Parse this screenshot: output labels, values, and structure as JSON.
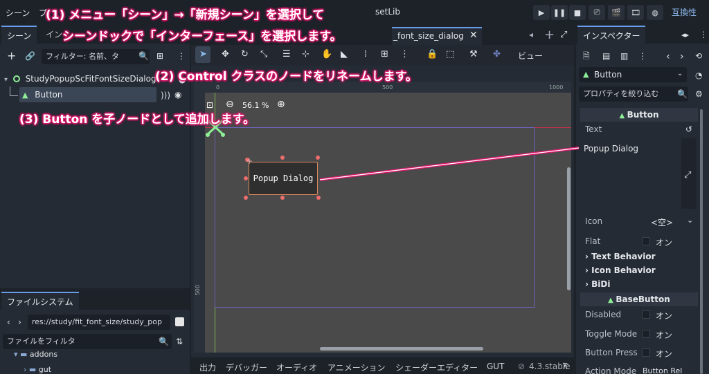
{
  "menubar": {
    "scene": "シーン",
    "project_partial": "プ",
    "assetlib_partial": "setLib",
    "compat": "互換性"
  },
  "scene_dock": {
    "tab_scene": "シーン",
    "tab_import_partial": "イン",
    "filter_placeholder": "フィルター: 名前、タ",
    "root_node": "StudyPopupScFitFontSizeDialog",
    "child_node": "Button"
  },
  "filesystem": {
    "tab": "ファイルシステム",
    "path": "res://study/fit_font_size/study_pop",
    "filter_placeholder": "ファイルをフィルタ",
    "folder1": "addons",
    "folder2": "gut"
  },
  "viewport": {
    "scene_tab_partial": "_font_size_dialog",
    "zoom": "56.1 %",
    "view_menu": "ビュー",
    "ruler_500": "500",
    "ruler_1000": "1000",
    "ruler_v500": "500",
    "ruler_0": "0",
    "button_text": "Popup Dialog"
  },
  "inspector": {
    "tab": "インスペクター",
    "node_type": "Button",
    "filter_placeholder": "プロパティを絞り込む",
    "section_button": "Button",
    "text_label": "Text",
    "text_value": "Popup Dialog",
    "icon_label": "Icon",
    "icon_value": "<空>",
    "flat_label": "Flat",
    "on": "オン",
    "group_text_behavior": "Text Behavior",
    "group_icon_behavior": "Icon Behavior",
    "group_bidi": "BiDi",
    "section_basebutton": "BaseButton",
    "disabled_label": "Disabled",
    "toggle_mode_label": "Toggle Mode",
    "button_press_label": "Button Press",
    "action_mode_label": "Action Mode",
    "action_mode_value": "Button Rel"
  },
  "bottom_bar": {
    "output": "出力",
    "debugger": "デバッガー",
    "audio": "オーディオ",
    "animation": "アニメーション",
    "shader_editor": "シェーダーエディター",
    "gut": "GUT",
    "version": "4.3.stable"
  },
  "callouts": {
    "step1_line1": "(1) メニュー「シーン」→「新規シーン」を選択して",
    "step1_line2": "シーンドックで「インターフェース」を選択します。",
    "step2": "(2) Control クラスのノードをリネームします。",
    "step3": "(3) Button を子ノードとして追加します。"
  },
  "colors": {
    "accent": "#699ce8",
    "callout": "#e0186e",
    "node_green": "#8eef97",
    "panel": "#252b34",
    "background": "#1d2229"
  }
}
